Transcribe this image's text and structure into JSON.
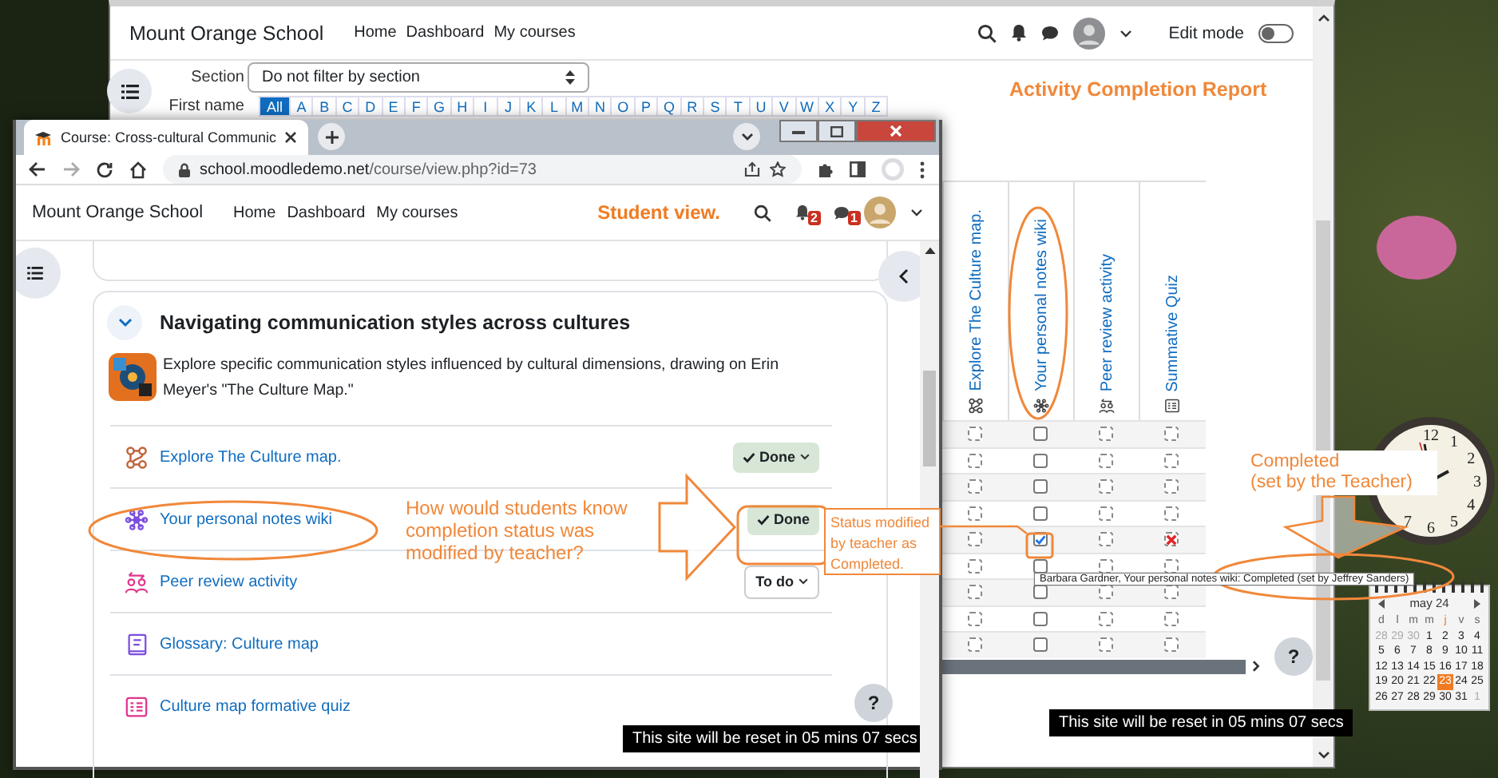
{
  "back_window": {
    "navbar": {
      "brand": "Mount Orange School",
      "links": [
        "Home",
        "Dashboard",
        "My courses"
      ],
      "edit_mode": {
        "label": "Edit mode",
        "on": false
      }
    },
    "filters": {
      "section_label": "Section",
      "section_value": "Do not filter by section",
      "first_name_label": "First name",
      "letters": [
        {
          "label": "All",
          "selected": true
        },
        {
          "label": "A",
          "selected": false
        },
        {
          "label": "B",
          "selected": false
        },
        {
          "label": "C",
          "selected": false
        },
        {
          "label": "D",
          "selected": false
        },
        {
          "label": "E",
          "selected": false
        },
        {
          "label": "F",
          "selected": false
        },
        {
          "label": "G",
          "selected": false
        },
        {
          "label": "H",
          "selected": false
        },
        {
          "label": "I",
          "selected": false
        },
        {
          "label": "J",
          "selected": false
        },
        {
          "label": "K",
          "selected": false
        },
        {
          "label": "L",
          "selected": false
        },
        {
          "label": "M",
          "selected": false
        },
        {
          "label": "N",
          "selected": false
        },
        {
          "label": "O",
          "selected": false
        },
        {
          "label": "P",
          "selected": false
        },
        {
          "label": "Q",
          "selected": false
        },
        {
          "label": "R",
          "selected": false
        },
        {
          "label": "S",
          "selected": false
        },
        {
          "label": "T",
          "selected": false
        },
        {
          "label": "U",
          "selected": false
        },
        {
          "label": "V",
          "selected": false
        },
        {
          "label": "W",
          "selected": false
        },
        {
          "label": "X",
          "selected": false
        },
        {
          "label": "Y",
          "selected": false
        },
        {
          "label": "Z",
          "selected": false
        }
      ]
    },
    "report": {
      "columns": [
        {
          "kind": "page",
          "title": "Explore The Culture map."
        },
        {
          "kind": "wiki",
          "title": "Your personal notes wiki"
        },
        {
          "kind": "workshop",
          "title": "Peer review activity"
        },
        {
          "kind": "quiz",
          "title": "Summative Quiz"
        }
      ],
      "rows": [
        {
          "cells": [
            {
              "kind": "auto",
              "checked": false
            },
            {
              "kind": "manual",
              "checked": false
            },
            {
              "kind": "auto",
              "checked": false
            },
            {
              "kind": "auto",
              "checked": false
            }
          ]
        },
        {
          "cells": [
            {
              "kind": "auto",
              "checked": false
            },
            {
              "kind": "manual",
              "checked": false
            },
            {
              "kind": "auto",
              "checked": false
            },
            {
              "kind": "auto",
              "checked": false
            }
          ]
        },
        {
          "cells": [
            {
              "kind": "auto",
              "checked": false
            },
            {
              "kind": "manual",
              "checked": false
            },
            {
              "kind": "auto",
              "checked": false
            },
            {
              "kind": "auto",
              "checked": false
            }
          ]
        },
        {
          "cells": [
            {
              "kind": "auto",
              "checked": false
            },
            {
              "kind": "manual",
              "checked": false
            },
            {
              "kind": "auto",
              "checked": false
            },
            {
              "kind": "auto",
              "checked": false
            }
          ]
        },
        {
          "cells": [
            {
              "kind": "auto",
              "checked": false
            },
            {
              "kind": "manual",
              "checked": true
            },
            {
              "kind": "auto",
              "checked": false
            },
            {
              "kind": "auto",
              "failed": true
            }
          ]
        },
        {
          "cells": [
            {
              "kind": "auto",
              "checked": false
            },
            {
              "kind": "manual",
              "checked": false
            },
            {
              "kind": "auto",
              "checked": false
            },
            {
              "kind": "auto",
              "checked": false
            }
          ]
        },
        {
          "cells": [
            {
              "kind": "auto",
              "checked": false
            },
            {
              "kind": "manual",
              "checked": false
            },
            {
              "kind": "auto",
              "checked": false
            },
            {
              "kind": "auto",
              "checked": false
            }
          ]
        },
        {
          "cells": [
            {
              "kind": "auto",
              "checked": false
            },
            {
              "kind": "manual",
              "checked": false
            },
            {
              "kind": "auto",
              "checked": false
            },
            {
              "kind": "auto",
              "checked": false
            }
          ]
        },
        {
          "cells": [
            {
              "kind": "auto",
              "checked": false
            },
            {
              "kind": "manual",
              "checked": false
            },
            {
              "kind": "auto",
              "checked": false
            },
            {
              "kind": "auto",
              "checked": false
            }
          ]
        }
      ]
    },
    "tooltip": "Barbara Gardner, Your personal notes wiki: Completed (set by Jeffrey Sanders)",
    "help": "?",
    "reset_notice": "This site will be reset in 05 mins 07 secs"
  },
  "front_window": {
    "tab_title": "Course: Cross-cultural Communic",
    "url_host": "school.moodledemo.net",
    "url_path": "/course/view.php?id=73",
    "navbar": {
      "brand": "Mount Orange School",
      "links": [
        "Home",
        "Dashboard",
        "My courses"
      ],
      "notifications": "2",
      "messages": "1"
    },
    "section": {
      "title": "Navigating communication styles across cultures",
      "expanded": true,
      "summary": "Explore specific communication styles influenced by cultural dimensions, drawing on Erin Meyer's \"The Culture Map.\"",
      "activities": [
        {
          "kind": "page",
          "title": "Explore The Culture map.",
          "completion": {
            "label": "Done",
            "done": true,
            "menu": true
          }
        },
        {
          "kind": "wiki",
          "title": "Your personal notes wiki",
          "completion": {
            "label": "Done",
            "done": true,
            "menu": false
          }
        },
        {
          "kind": "workshop",
          "title": "Peer review activity",
          "completion": {
            "label": "To do",
            "done": false,
            "menu": true
          }
        },
        {
          "kind": "glossary",
          "title": "Glossary: Culture map"
        },
        {
          "kind": "quiz",
          "title": "Culture map formative quiz"
        }
      ]
    },
    "help": "?",
    "reset_notice": "This site will be reset in 05 mins 07 secs"
  },
  "annotations": {
    "report_title": "Activity Completion Report",
    "student_view": "Student view.",
    "question": "How would students know completion status was modified by teacher?",
    "status_note": "Status modified by teacher as Completed.",
    "teacher_note": [
      "Completed",
      "(set by the Teacher)"
    ]
  },
  "gadgets": {
    "clock_numerals": [
      "12",
      "1",
      "2",
      "3",
      "4",
      "5",
      "6",
      "7"
    ],
    "calendar": {
      "month": "may 24",
      "weekdays": [
        {
          "label": "d",
          "selected": false
        },
        {
          "label": "l",
          "selected": false
        },
        {
          "label": "m",
          "selected": false
        },
        {
          "label": "m",
          "selected": false
        },
        {
          "label": "j",
          "selected": true
        },
        {
          "label": "v",
          "selected": false
        },
        {
          "label": "s",
          "selected": false
        }
      ],
      "days": [
        {
          "label": "28",
          "muted": true,
          "selected": false
        },
        {
          "label": "29",
          "muted": true,
          "selected": false
        },
        {
          "label": "30",
          "muted": true,
          "selected": false
        },
        {
          "label": "1",
          "muted": false,
          "selected": false
        },
        {
          "label": "2",
          "muted": false,
          "selected": false
        },
        {
          "label": "3",
          "muted": false,
          "selected": false
        },
        {
          "label": "4",
          "muted": false,
          "selected": false
        },
        {
          "label": "5",
          "muted": false,
          "selected": false
        },
        {
          "label": "6",
          "muted": false,
          "selected": false
        },
        {
          "label": "7",
          "muted": false,
          "selected": false
        },
        {
          "label": "8",
          "muted": false,
          "selected": false
        },
        {
          "label": "9",
          "muted": false,
          "selected": false
        },
        {
          "label": "10",
          "muted": false,
          "selected": false
        },
        {
          "label": "11",
          "muted": false,
          "selected": false
        },
        {
          "label": "12",
          "muted": false,
          "selected": false
        },
        {
          "label": "13",
          "muted": false,
          "selected": false
        },
        {
          "label": "14",
          "muted": false,
          "selected": false
        },
        {
          "label": "15",
          "muted": false,
          "selected": false
        },
        {
          "label": "16",
          "muted": false,
          "selected": false
        },
        {
          "label": "17",
          "muted": false,
          "selected": false
        },
        {
          "label": "18",
          "muted": false,
          "selected": false
        },
        {
          "label": "19",
          "muted": false,
          "selected": false
        },
        {
          "label": "20",
          "muted": false,
          "selected": false
        },
        {
          "label": "21",
          "muted": false,
          "selected": false
        },
        {
          "label": "22",
          "muted": false,
          "selected": false
        },
        {
          "label": "23",
          "muted": false,
          "selected": true
        },
        {
          "label": "24",
          "muted": false,
          "selected": false
        },
        {
          "label": "25",
          "muted": false,
          "selected": false
        },
        {
          "label": "26",
          "muted": false,
          "selected": false
        },
        {
          "label": "27",
          "muted": false,
          "selected": false
        },
        {
          "label": "28",
          "muted": false,
          "selected": false
        },
        {
          "label": "29",
          "muted": false,
          "selected": false
        },
        {
          "label": "30",
          "muted": false,
          "selected": false
        },
        {
          "label": "31",
          "muted": false,
          "selected": false
        },
        {
          "label": "1",
          "muted": true,
          "selected": false
        }
      ]
    }
  }
}
